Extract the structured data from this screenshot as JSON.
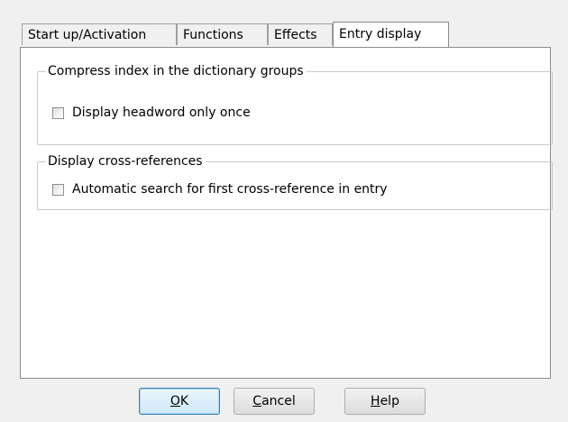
{
  "tabs": [
    {
      "label": "Start up/Activation",
      "active": false
    },
    {
      "label": "Functions",
      "active": false
    },
    {
      "label": "Effects",
      "active": false
    },
    {
      "label": "Entry display",
      "active": true
    }
  ],
  "groups": {
    "compress_index": {
      "title": "Compress index in the dictionary groups",
      "checkbox_label": "Display headword only once",
      "checked": false
    },
    "cross_references": {
      "title": "Display cross-references",
      "checkbox_label": "Automatic search for first cross-reference in entry",
      "checked": false
    }
  },
  "buttons": {
    "ok": {
      "mnemonic": "O",
      "rest": "K"
    },
    "cancel": {
      "mnemonic": "C",
      "rest": "ancel"
    },
    "help": {
      "mnemonic": "H",
      "rest": "elp"
    }
  }
}
